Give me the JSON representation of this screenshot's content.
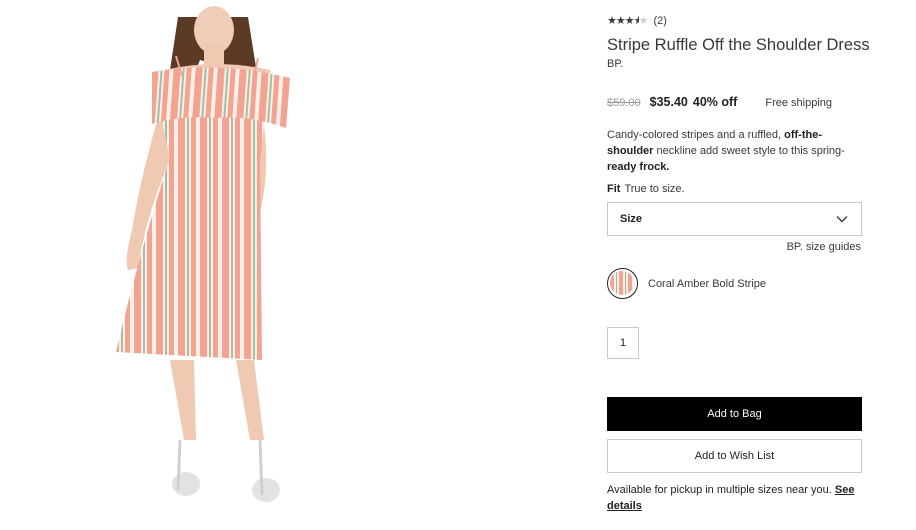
{
  "product": {
    "rating": {
      "stars": 3.5,
      "max_stars": 5,
      "review_count": "(2)"
    },
    "title": "Stripe Ruffle Off the Shoulder Dress",
    "brand": "BP.",
    "price": {
      "original": "$59.00",
      "sale": "$35.40",
      "discount": "40% off",
      "shipping": "Free shipping"
    },
    "description": {
      "part1": "Candy-colored stripes and a ruffled, ",
      "bold1": "off-the-shoulder",
      "part2": " neckline add sweet style to this spring-",
      "bold2": "ready frock."
    },
    "fit": {
      "label": "Fit",
      "value": "True to size."
    },
    "size_select": {
      "label": "Size"
    },
    "size_guides": "BP. size guides",
    "color": {
      "name": "Coral Amber Bold Stripe"
    },
    "quantity": "1",
    "buttons": {
      "add_to_bag": "Add to Bag",
      "add_to_wish_list": "Add to Wish List"
    },
    "pickup": {
      "text": "Available for pickup in multiple sizes near you. ",
      "link": "See details"
    }
  },
  "colors": {
    "stripe_coral": "#f3a391",
    "stripe_cream": "#f6efe6",
    "stripe_green": "#9eb59a",
    "button_black": "#000000"
  },
  "icons": [
    "star-icon",
    "chevron-down-icon"
  ]
}
